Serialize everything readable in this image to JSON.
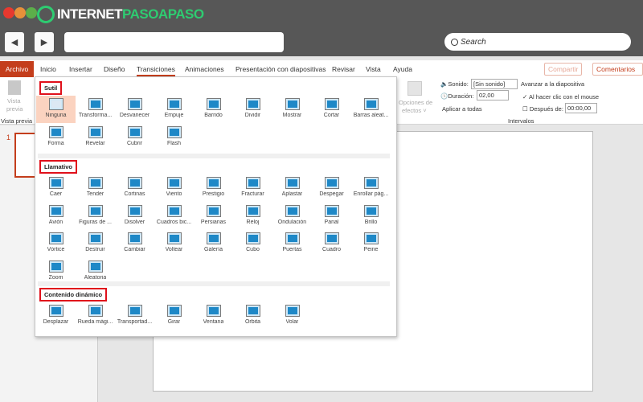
{
  "browser": {
    "logo_left": "INTERNET",
    "logo_right": "PASOAPASO",
    "search_placeholder": "Search",
    "back": "◀",
    "forward": "▶"
  },
  "colors": {
    "accent": "#c43e1c",
    "gallery_icon": "#1e88c7",
    "highlight_box": "#e0101b",
    "logo_green": "#2ecc71"
  },
  "ribbon": {
    "tabs": [
      "Archivo",
      "Inicio",
      "Insertar",
      "Diseño",
      "Transiciones",
      "Animaciones",
      "Presentación con diapositivas",
      "Revisar",
      "Vista",
      "Ayuda"
    ],
    "active_tab": "Transiciones",
    "share": "Compartir",
    "comments": "Comentarios",
    "preview": {
      "label1": "Vista",
      "label2": "previa",
      "group": "Vista previa"
    },
    "effect_options": {
      "line1": "Opciones de",
      "line2": "efectos ˅"
    },
    "sound_label": "Sonido:",
    "sound_value": "[Sin sonido]",
    "duration_label": "Duración:",
    "duration_value": "02,00",
    "apply_all": "Aplicar a todas",
    "advance": "Avanzar a la diapositiva",
    "on_click": "Al hacer clic con el mouse",
    "on_click_checked": true,
    "after": "Después de:",
    "after_value": "00:00,00",
    "after_checked": false,
    "group_intervals": "Intervalos"
  },
  "slides": {
    "number": "1"
  },
  "gallery": {
    "sections": [
      {
        "title": "Sutil",
        "items": [
          "Ninguna",
          "Transforma...",
          "Desvanecer",
          "Empuje",
          "Barrido",
          "Dividir",
          "Mostrar",
          "Cortar",
          "Barras aleat...",
          "Forma",
          "Revelar",
          "Cubrir",
          "Flash"
        ]
      },
      {
        "title": "Llamativo",
        "items": [
          "Caer",
          "Tender",
          "Cortinas",
          "Viento",
          "Prestigio",
          "Fracturar",
          "Aplastar",
          "Despegar",
          "Enrollar pág...",
          "Avión",
          "Figuras de ...",
          "Disolver",
          "Cuadros bic...",
          "Persianas",
          "Reloj",
          "Ondulación",
          "Panal",
          "Brillo",
          "Vórtice",
          "Destruir",
          "Cambiar",
          "Voltear",
          "Galería",
          "Cubo",
          "Puertas",
          "Cuadro",
          "Peine",
          "Zoom",
          "Aleatoria"
        ]
      },
      {
        "title": "Contenido dinámico",
        "items": [
          "Desplazar",
          "Rueda mági...",
          "Transportad...",
          "Girar",
          "Ventana",
          "Órbita",
          "Volar"
        ]
      }
    ],
    "selected": "Ninguna"
  }
}
